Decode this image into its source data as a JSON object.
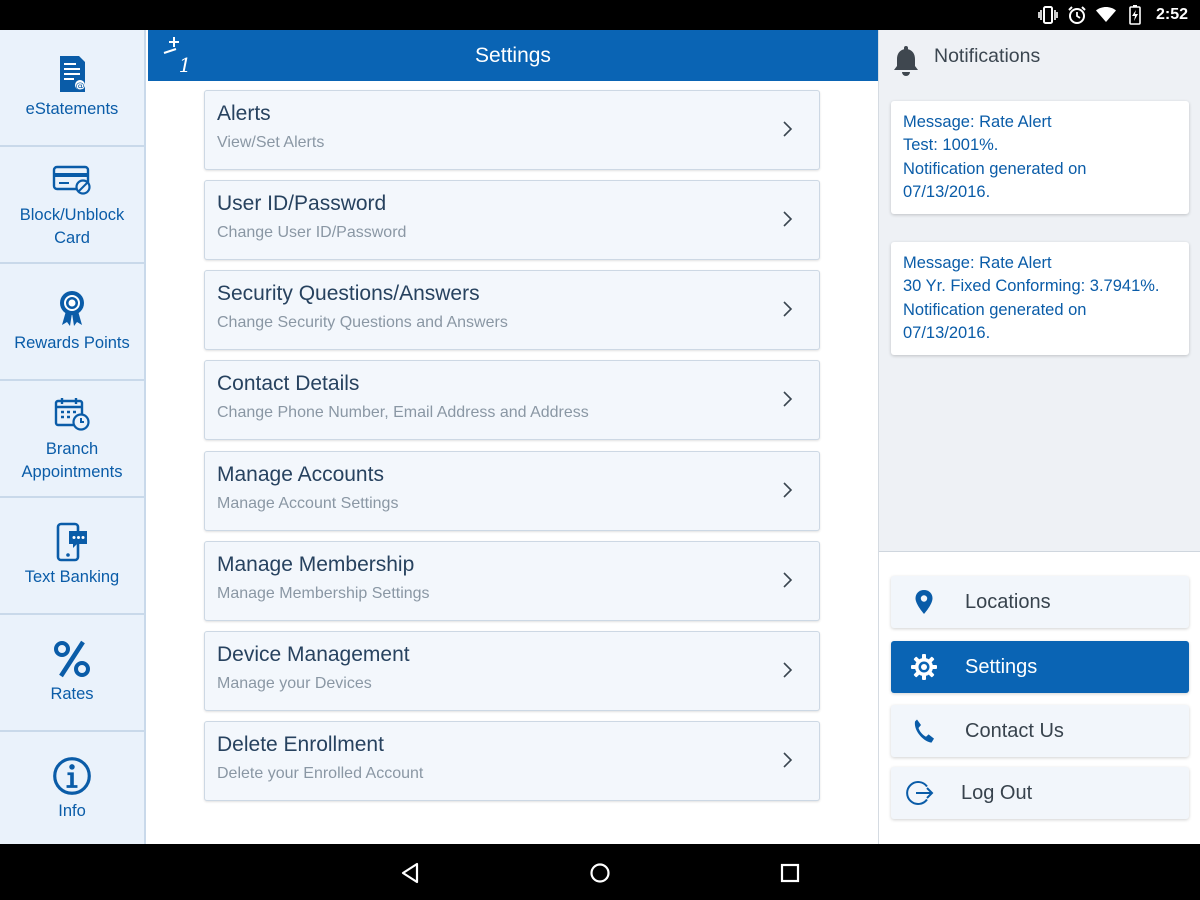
{
  "status_bar": {
    "time": "2:52",
    "icons": [
      "vibrate-icon",
      "alarm-icon",
      "wifi-icon",
      "battery-charging-icon"
    ]
  },
  "app": {
    "title": "Settings",
    "accent": "#0a64b4",
    "logo": "bank-logo-icon"
  },
  "sidebar": {
    "items": [
      {
        "label": "eStatements",
        "icon": "estatement-icon"
      },
      {
        "label": "Block/Unblock\nCard",
        "icon": "card-block-icon"
      },
      {
        "label": "Rewards Points",
        "icon": "award-ribbon-icon"
      },
      {
        "label": "Branch\nAppointments",
        "icon": "calendar-clock-icon"
      },
      {
        "label": "Text Banking",
        "icon": "phone-chat-icon"
      },
      {
        "label": "Rates",
        "icon": "percent-icon"
      },
      {
        "label": "Info",
        "icon": "info-icon"
      }
    ]
  },
  "settings": {
    "items": [
      {
        "title": "Alerts",
        "subtitle": "View/Set Alerts"
      },
      {
        "title": "User ID/Password",
        "subtitle": "Change User ID/Password"
      },
      {
        "title": "Security Questions/Answers",
        "subtitle": "Change Security Questions and Answers"
      },
      {
        "title": "Contact Details",
        "subtitle": "Change Phone Number, Email Address and Address"
      },
      {
        "title": "Manage Accounts",
        "subtitle": "Manage Account Settings"
      },
      {
        "title": "Manage Membership",
        "subtitle": "Manage Membership Settings"
      },
      {
        "title": "Device Management",
        "subtitle": "Manage your Devices"
      },
      {
        "title": "Delete Enrollment",
        "subtitle": "Delete your Enrolled Account"
      }
    ]
  },
  "notifications": {
    "title": "Notifications",
    "items": [
      {
        "lines": [
          "Message: Rate Alert",
          "Test: 1001%.",
          "Notification generated on",
          "07/13/2016."
        ]
      },
      {
        "lines": [
          "Message: Rate Alert",
          "30 Yr. Fixed Conforming: 3.7941%.",
          "Notification generated on",
          "07/13/2016."
        ]
      }
    ]
  },
  "right_nav": {
    "items": [
      {
        "label": "Locations",
        "icon": "location-pin-icon",
        "active": false
      },
      {
        "label": "Settings",
        "icon": "gear-icon",
        "active": true
      },
      {
        "label": "Contact Us",
        "icon": "phone-icon",
        "active": false
      },
      {
        "label": "Log Out",
        "icon": "logout-icon",
        "active": false
      }
    ]
  },
  "bottom_nav": {
    "icons": [
      "back-icon",
      "home-icon",
      "recents-icon"
    ]
  }
}
